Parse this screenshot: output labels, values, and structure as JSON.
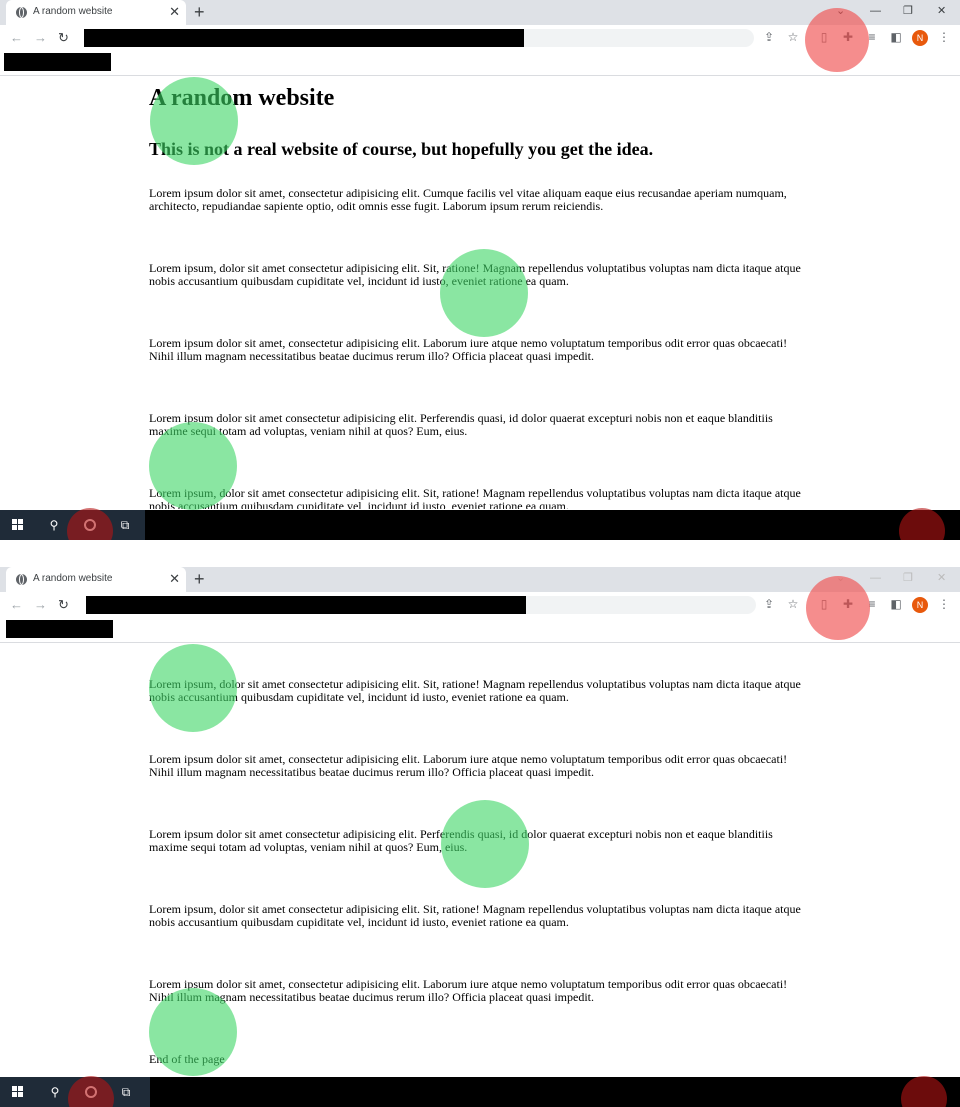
{
  "browser": {
    "tab_title": "A random website",
    "tab_close": "✕",
    "new_tab": "+",
    "minimize": "—",
    "restore": "❐",
    "close": "✕",
    "avatar_letter": "N"
  },
  "page": {
    "heading": "A random website",
    "subheading": "This is not a real website of course, but hopefully you get the idea.",
    "paragraphs": [
      "Lorem ipsum dolor sit amet, consectetur adipisicing elit. Cumque facilis vel vitae aliquam eaque eius recusandae aperiam numquam, architecto, repudiandae sapiente optio, odit omnis esse fugit. Laborum ipsum rerum reiciendis.",
      "Lorem ipsum, dolor sit amet consectetur adipisicing elit. Sit, ratione! Magnam repellendus voluptatibus voluptas nam dicta itaque atque nobis accusantium quibusdam cupiditate vel, incidunt id iusto, eveniet ratione ea quam.",
      "Lorem ipsum dolor sit amet, consectetur adipisicing elit. Laborum iure atque nemo voluptatum temporibus odit error quas obcaecati! Nihil illum magnam necessitatibus beatae ducimus rerum illo? Officia placeat quasi impedit.",
      "Lorem ipsum dolor sit amet consectetur adipisicing elit. Perferendis quasi, id dolor quaerat excepturi nobis non et eaque blanditiis maxime sequi totam ad voluptas, veniam nihil at quos? Eum, eius."
    ],
    "end_text": "End of the page"
  },
  "annotations": {
    "green": "#3cd664",
    "red": "#f05050",
    "dark_red": "#b41414"
  }
}
